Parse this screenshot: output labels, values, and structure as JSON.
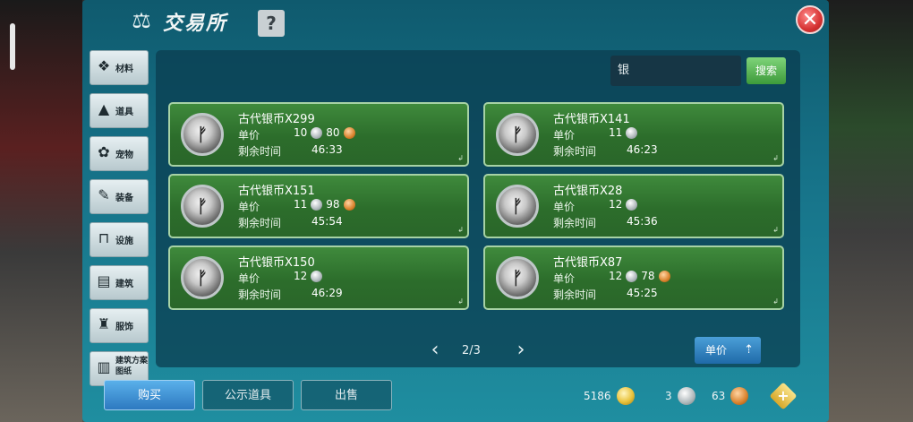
{
  "window": {
    "title": "交易所",
    "help_label": "?",
    "close_label": "✕"
  },
  "sidebar": {
    "items": [
      {
        "label": "材料",
        "icon": "materials-icon"
      },
      {
        "label": "道具",
        "icon": "props-icon"
      },
      {
        "label": "宠物",
        "icon": "pet-paw-icon"
      },
      {
        "label": "装备",
        "icon": "equipment-icon"
      },
      {
        "label": "设施",
        "icon": "facility-icon"
      },
      {
        "label": "建筑",
        "icon": "building-icon"
      },
      {
        "label": "服饰",
        "icon": "clothing-icon"
      },
      {
        "label": "建筑方案图纸",
        "icon": "blueprint-icon"
      }
    ]
  },
  "search": {
    "value": "银",
    "button_label": "搜索"
  },
  "listings": {
    "price_label": "单价",
    "time_label": "剩余时间",
    "items": [
      {
        "name": "古代银币X299",
        "silver": "10",
        "copper": "80",
        "time": "46:33"
      },
      {
        "name": "古代银币X141",
        "silver": "11",
        "copper": "",
        "time": "46:23"
      },
      {
        "name": "古代银币X151",
        "silver": "11",
        "copper": "98",
        "time": "45:54"
      },
      {
        "name": "古代银币X28",
        "silver": "12",
        "copper": "",
        "time": "45:36"
      },
      {
        "name": "古代银币X150",
        "silver": "12",
        "copper": "",
        "time": "46:29"
      },
      {
        "name": "古代银币X87",
        "silver": "12",
        "copper": "78",
        "time": "45:25"
      }
    ]
  },
  "pager": {
    "text": "2/3",
    "prev": "‹",
    "next": "›"
  },
  "sort": {
    "label": "单价"
  },
  "tabs": {
    "buy": "购买",
    "public": "公示道具",
    "sell": "出售"
  },
  "wallet": {
    "gold": "5186",
    "silver": "3",
    "copper": "63"
  }
}
